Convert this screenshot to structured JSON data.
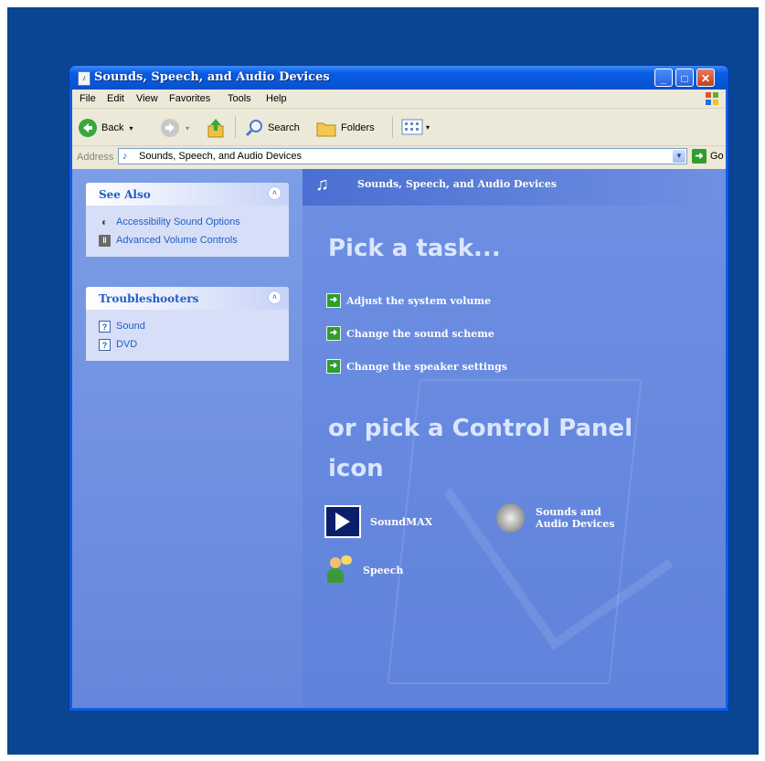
{
  "window": {
    "title": "Sounds, Speech, and Audio Devices",
    "controls": {
      "minimize": "_",
      "maximize": "□",
      "close": "✕"
    }
  },
  "menubar": {
    "items": [
      "File",
      "Edit",
      "View",
      "Favorites",
      "Tools",
      "Help"
    ]
  },
  "toolbar": {
    "back_label": "Back",
    "search_label": "Search",
    "folders_label": "Folders"
  },
  "addressbar": {
    "label": "Address",
    "value": "Sounds, Speech, and Audio Devices",
    "go_label": "Go"
  },
  "sidebar": {
    "see_also": {
      "title": "See Also",
      "items": [
        {
          "label": "Accessibility Sound Options",
          "icon": "speaker-icon"
        },
        {
          "label": "Advanced Volume Controls",
          "icon": "mixer-icon"
        }
      ]
    },
    "troubleshooters": {
      "title": "Troubleshooters",
      "items": [
        {
          "label": "Sound",
          "icon": "help-icon"
        },
        {
          "label": "DVD",
          "icon": "help-icon"
        }
      ]
    }
  },
  "main": {
    "header": "Sounds, Speech, and Audio Devices",
    "pick_task_heading": "Pick a task...",
    "tasks": [
      "Adjust the system volume",
      "Change the sound scheme",
      "Change the speaker settings"
    ],
    "pick_icon_heading": "or pick a Control Panel icon",
    "icons": [
      {
        "label": "SoundMAX",
        "icon": "soundmax-icon"
      },
      {
        "label": "Sounds and Audio Devices",
        "icon": "speaker-icon"
      },
      {
        "label": "Speech",
        "icon": "speech-icon"
      }
    ]
  },
  "colors": {
    "desktop": "#0a4592",
    "titlebar": "#0a5ce6",
    "content_blue": "#6d8ee3",
    "link": "#215dc6",
    "task_arrow": "#2f9e2f"
  }
}
